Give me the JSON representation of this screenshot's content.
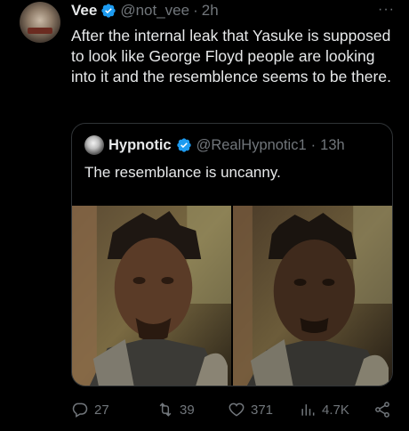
{
  "tweet": {
    "author_name": "Vee",
    "author_handle": "@not_vee",
    "separator": "·",
    "time": "2h",
    "more_label": "···",
    "text": "After the internal leak that Yasuke is supposed to look like George Floyd people are looking into it and the resemblence seems to be there."
  },
  "quote": {
    "author_name": "Hypnotic",
    "author_handle": "@RealHypnotic1",
    "separator": "·",
    "time": "13h",
    "text": "The resemblance is uncanny."
  },
  "actions": {
    "replies": "27",
    "retweets": "39",
    "likes": "371",
    "views": "4.7K"
  },
  "icons": {
    "verified": "verified-badge-icon",
    "reply": "reply-icon",
    "retweet": "retweet-icon",
    "like": "heart-icon",
    "views": "views-icon",
    "share": "share-icon"
  },
  "colors": {
    "background": "#000000",
    "text": "#e7e9ea",
    "muted": "#71767b",
    "verified": "#1d9bf0",
    "border": "#2f3336"
  }
}
